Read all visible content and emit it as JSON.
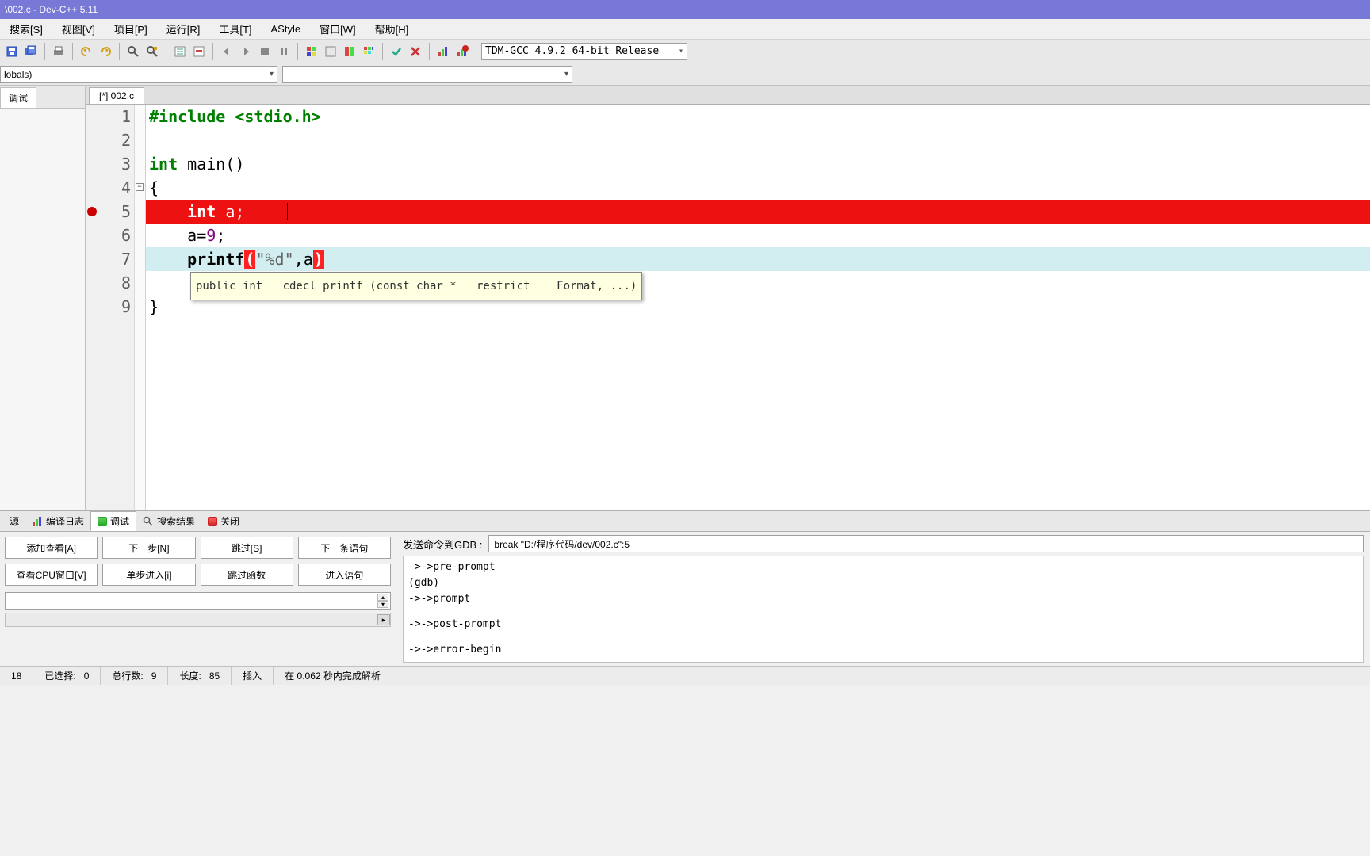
{
  "title": "\\002.c - Dev-C++ 5.11",
  "menu": {
    "search": "搜索[S]",
    "view": "视图[V]",
    "project": "项目[P]",
    "run": "运行[R]",
    "tools": "工具[T]",
    "astyle": "AStyle",
    "window": "窗口[W]",
    "help": "帮助[H]"
  },
  "compiler_choice": "TDM-GCC 4.9.2 64-bit Release",
  "globals_combo": "lobals)",
  "left_tab": "调试",
  "file_tab": "[*] 002.c",
  "gutter": [
    "1",
    "2",
    "3",
    "4",
    "5",
    "6",
    "7",
    "8",
    "9"
  ],
  "code": {
    "l1_pre": "#include ",
    "l1_hdr": "<stdio.h>",
    "l3_kw": "int",
    "l3_rest": " main",
    "l3_par": "()",
    "l4": "{",
    "l5_indent": "    ",
    "l5_kw": "int",
    "l5_rest": " a;",
    "l6_indent": "    ",
    "l6_a": "a",
    "l6_eq": "=",
    "l6_num": "9",
    "l6_semi": ";",
    "l7_indent": "    ",
    "l7_fn": "printf",
    "l7_p1": "(",
    "l7_str": "\"%d\"",
    "l7_comma": ",",
    "l7_arg": "a",
    "l7_p2": ")",
    "l9": "}"
  },
  "tooltip": "public int __cdecl printf (const char * __restrict__ _Format, ...)",
  "bottom_tabs": {
    "resource": "源",
    "compile_log": "编译日志",
    "debug": "调试",
    "search_result": "搜索结果",
    "close": "关闭"
  },
  "debug_buttons": {
    "add_watch": "添加查看[A]",
    "next": "下一步[N]",
    "skip": "跳过[S]",
    "next_stmt": "下一条语句",
    "cpu_window": "查看CPU窗口[V]",
    "step_into": "单步进入[i]",
    "skip_fn": "跳过函数",
    "into_stmt": "进入语句"
  },
  "gdb": {
    "send_label": "发送命令到GDB :",
    "send_value": "break \"D:/程序代码/dev/002.c\":5",
    "out1": "->->pre-prompt",
    "out2": "(gdb)",
    "out3": "->->prompt",
    "out4": "->->post-prompt",
    "out5": "->->error-begin"
  },
  "status": {
    "line": "18",
    "selected_label": "已选择:",
    "selected_val": "0",
    "total_label": "总行数:",
    "total_val": "9",
    "length_label": "长度:",
    "length_val": "85",
    "insert": "插入",
    "parse": "在 0.062 秒内完成解析"
  }
}
